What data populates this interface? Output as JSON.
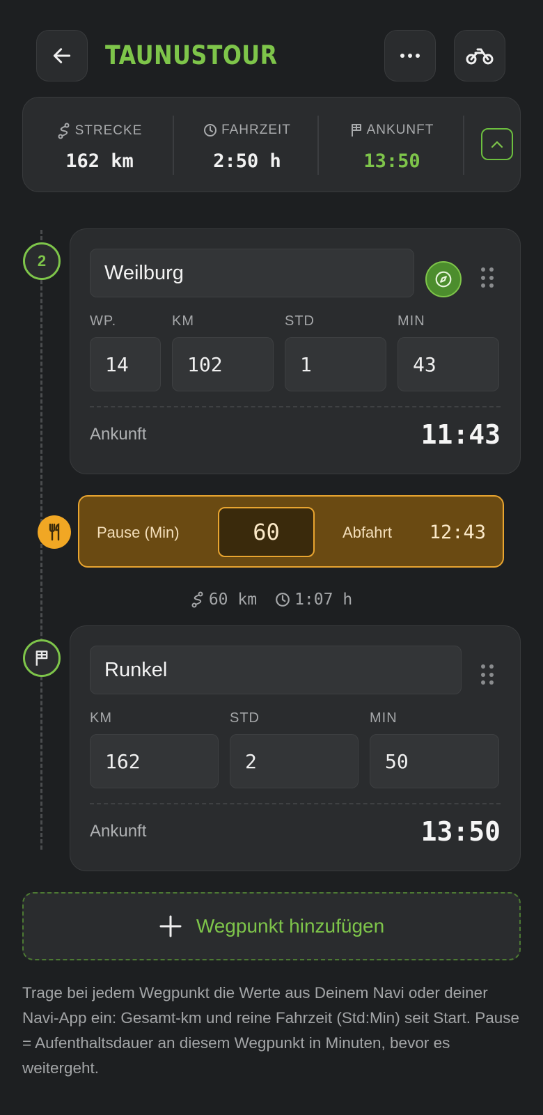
{
  "header": {
    "title": "TAUNUSTOUR",
    "back_icon": "arrow-left-icon",
    "menu_icon": "more-horizontal-icon",
    "vehicle_icon": "motorbike-icon"
  },
  "summary": {
    "distance": {
      "label": "STRECKE",
      "value": "162 km"
    },
    "drive_time": {
      "label": "FAHRZEIT",
      "value": "2:50 h"
    },
    "arrival": {
      "label": "ANKUNFT",
      "value": "13:50"
    }
  },
  "waypoints": [
    {
      "node_label": "2",
      "name": "Weilburg",
      "fields": [
        {
          "label": "WP.",
          "value": "14"
        },
        {
          "label": "KM",
          "value": "102"
        },
        {
          "label": "STD",
          "value": "1"
        },
        {
          "label": "MIN",
          "value": "43"
        }
      ],
      "arrival_label": "Ankunft",
      "arrival_time": "11:43"
    },
    {
      "name": "Runkel",
      "fields": [
        {
          "label": "KM",
          "value": "162"
        },
        {
          "label": "STD",
          "value": "2"
        },
        {
          "label": "MIN",
          "value": "50"
        }
      ],
      "arrival_label": "Ankunft",
      "arrival_time": "13:50"
    }
  ],
  "pause": {
    "label": "Pause (Min)",
    "value": "60",
    "departure_label": "Abfahrt",
    "departure_time": "12:43"
  },
  "segment": {
    "distance": "60 km",
    "time": "1:07 h"
  },
  "add_button": {
    "label": "Wegpunkt hinzufügen"
  },
  "help_text": "Trage bei jedem Wegpunkt die Werte aus Deinem Navi oder deiner Navi-App ein: Gesamt-km und reine Fahrzeit (Std:Min) seit Start. Pause = Aufenthaltsdauer an diesem Wegpunkt in Minuten, bevor es weitergeht.",
  "colors": {
    "accent": "#7ec54a",
    "background": "#1d1f21",
    "card": "#2a2c2e",
    "pause_bg": "#6a4a12",
    "pause_border": "#e9a530"
  }
}
